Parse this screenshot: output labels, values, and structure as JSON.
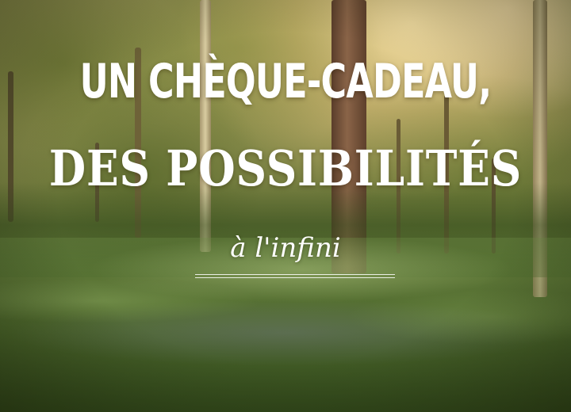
{
  "image": {
    "scene": "sunlit forest with bluebell-covered floor",
    "colors": {
      "text": "#ffffff",
      "foliage": "#7a8540",
      "sunlight": "#ffe0a0",
      "trunk": "#6a4a32",
      "bluebell": "#8c82c8"
    }
  },
  "headline": {
    "line1": "UN CHÈQUE-CADEAU,",
    "line2": "DES POSSIBILITÉS",
    "line3": "à l'infini"
  }
}
